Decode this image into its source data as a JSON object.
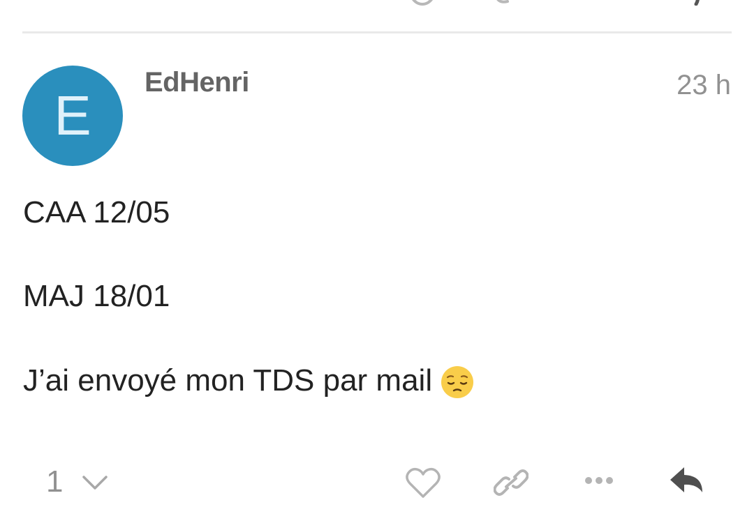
{
  "prev_post_actions": {
    "icons": [
      "heart-icon",
      "link-icon",
      "reply-icon"
    ]
  },
  "post": {
    "author": {
      "initial": "E",
      "username": "EdHenri",
      "avatar_color": "#2a8fbd"
    },
    "time": "23 h",
    "lines": [
      "CAA 12/05",
      "MAJ 18/01",
      "J’ai envoyé mon TDS par mail"
    ],
    "emoji": "pensive-face"
  },
  "actions": {
    "like_count": "1",
    "icons": [
      "chevron-down-icon",
      "heart-icon",
      "link-icon",
      "more-icon",
      "reply-icon"
    ]
  }
}
